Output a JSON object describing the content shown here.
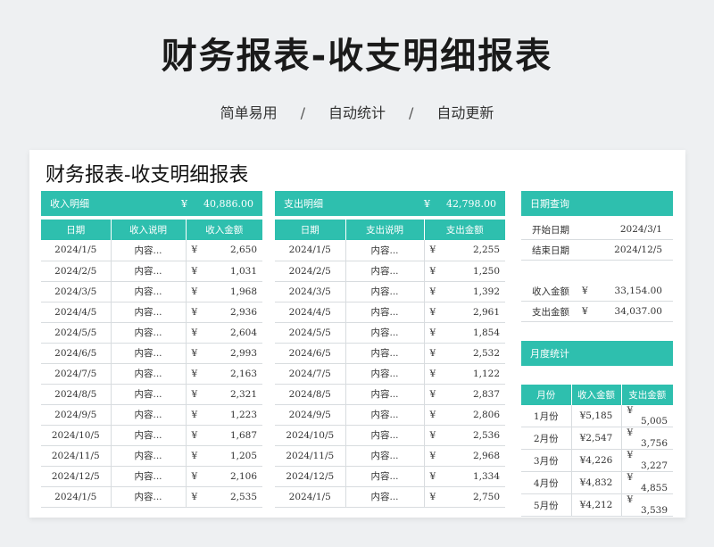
{
  "hero": {
    "title": "财务报表-收支明细报表",
    "tags": [
      "简单易用",
      "自动统计",
      "自动更新"
    ],
    "separator": "/"
  },
  "sheet": {
    "title": "财务报表-收支明细报表"
  },
  "income": {
    "label": "收入明细",
    "currency": "¥",
    "total": "40,886.00",
    "headers": [
      "日期",
      "收入说明",
      "收入金额"
    ],
    "rows": [
      {
        "date": "2024/1/5",
        "desc": "内容...",
        "amount": "2,650"
      },
      {
        "date": "2024/2/5",
        "desc": "内容...",
        "amount": "1,031"
      },
      {
        "date": "2024/3/5",
        "desc": "内容...",
        "amount": "1,968"
      },
      {
        "date": "2024/4/5",
        "desc": "内容...",
        "amount": "2,936"
      },
      {
        "date": "2024/5/5",
        "desc": "内容...",
        "amount": "2,604"
      },
      {
        "date": "2024/6/5",
        "desc": "内容...",
        "amount": "2,993"
      },
      {
        "date": "2024/7/5",
        "desc": "内容...",
        "amount": "2,163"
      },
      {
        "date": "2024/8/5",
        "desc": "内容...",
        "amount": "2,321"
      },
      {
        "date": "2024/9/5",
        "desc": "内容...",
        "amount": "1,223"
      },
      {
        "date": "2024/10/5",
        "desc": "内容...",
        "amount": "1,687"
      },
      {
        "date": "2024/11/5",
        "desc": "内容...",
        "amount": "1,205"
      },
      {
        "date": "2024/12/5",
        "desc": "内容...",
        "amount": "2,106"
      },
      {
        "date": "2024/1/5",
        "desc": "内容...",
        "amount": "2,535"
      }
    ]
  },
  "expense": {
    "label": "支出明细",
    "currency": "¥",
    "total": "42,798.00",
    "headers": [
      "日期",
      "支出说明",
      "支出金额"
    ],
    "rows": [
      {
        "date": "2024/1/5",
        "desc": "内容...",
        "amount": "2,255"
      },
      {
        "date": "2024/2/5",
        "desc": "内容...",
        "amount": "1,250"
      },
      {
        "date": "2024/3/5",
        "desc": "内容...",
        "amount": "1,392"
      },
      {
        "date": "2024/4/5",
        "desc": "内容...",
        "amount": "2,961"
      },
      {
        "date": "2024/5/5",
        "desc": "内容...",
        "amount": "1,854"
      },
      {
        "date": "2024/6/5",
        "desc": "内容...",
        "amount": "2,532"
      },
      {
        "date": "2024/7/5",
        "desc": "内容...",
        "amount": "1,122"
      },
      {
        "date": "2024/8/5",
        "desc": "内容...",
        "amount": "2,837"
      },
      {
        "date": "2024/9/5",
        "desc": "内容...",
        "amount": "2,806"
      },
      {
        "date": "2024/10/5",
        "desc": "内容...",
        "amount": "2,536"
      },
      {
        "date": "2024/11/5",
        "desc": "内容...",
        "amount": "2,968"
      },
      {
        "date": "2024/12/5",
        "desc": "内容...",
        "amount": "1,334"
      },
      {
        "date": "2024/1/5",
        "desc": "内容...",
        "amount": "2,750"
      }
    ]
  },
  "query": {
    "label": "日期查询",
    "start_label": "开始日期",
    "start_value": "2024/3/1",
    "end_label": "结束日期",
    "end_value": "2024/12/5",
    "income_label": "收入金额",
    "income_currency": "¥",
    "income_value": "33,154.00",
    "expense_label": "支出金额",
    "expense_currency": "¥",
    "expense_value": "34,037.00"
  },
  "monthly": {
    "label": "月度统计",
    "headers": [
      "月份",
      "收入金额",
      "支出金额"
    ],
    "rows": [
      {
        "month": "1月份",
        "income": "¥5,185",
        "exp_y": "¥",
        "expense": "5,005"
      },
      {
        "month": "2月份",
        "income": "¥2,547",
        "exp_y": "¥",
        "expense": "3,756"
      },
      {
        "month": "3月份",
        "income": "¥4,226",
        "exp_y": "¥",
        "expense": "3,227"
      },
      {
        "month": "4月份",
        "income": "¥4,832",
        "exp_y": "¥",
        "expense": "4,855"
      },
      {
        "month": "5月份",
        "income": "¥4,212",
        "exp_y": "¥",
        "expense": "3,539"
      }
    ]
  },
  "colors": {
    "accent": "#2ebfae",
    "background": "#eef0f2",
    "grid": "#d8dcdf"
  }
}
